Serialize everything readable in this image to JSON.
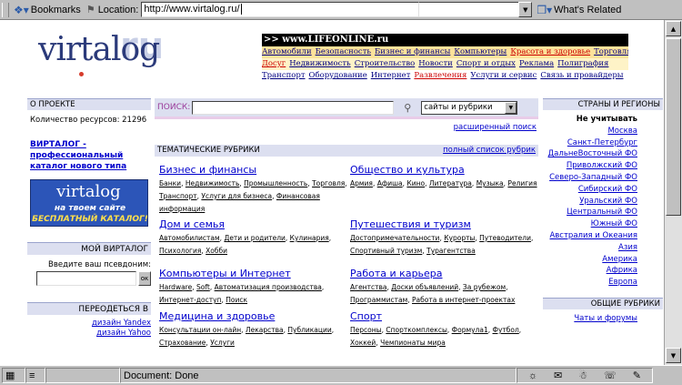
{
  "browser": {
    "bookmarks_label": "Bookmarks",
    "location_label": "Location:",
    "url": "http://www.virtalog.ru/",
    "whats_related": "What's Related",
    "status_text": "Document: Done"
  },
  "logo": {
    "text": "virtalog",
    "suffix": "ru"
  },
  "lifeonline": {
    "header": ">> www.LIFEONLINE.ru",
    "row1": [
      "Автомобили",
      "Безопасность",
      "Бизнес и финансы",
      "Компьютеры",
      "Красота и здоровье",
      "Торговля"
    ],
    "row2": [
      "Досуг",
      "Недвижимость",
      "Строительство",
      "Новости",
      "Спорт и отдых",
      "Реклама",
      "Полиграфия"
    ],
    "row3": [
      "Транспорт",
      "Оборудование",
      "Интернет",
      "Развлечения",
      "Услуги и сервис",
      "Связь и провайдеры"
    ]
  },
  "left": {
    "about_head": "О ПРОЕКТЕ",
    "resource_count": "Количество ресурсов: 21296",
    "promo_link": "ВИРТАЛОГ - профессиональный каталог нового типа",
    "banner_logo": "virtalog",
    "banner_line1": "на твоем сайте",
    "banner_line2": "БЕСПЛАТНЫЙ КАТАЛОГ!",
    "my_head": "МОЙ ВИРТАЛОГ",
    "nick_label": "Введите ваш псевдоним:",
    "ok_label": "ок",
    "goto_head": "ПЕРЕОДЕТЬСЯ В",
    "goto_links": [
      "дизайн Yandex",
      "дизайн Yahoo"
    ]
  },
  "search": {
    "label": "ПОИСК:",
    "scope": "сайты и рубрики",
    "extended": "расширенный поиск"
  },
  "rubrics": {
    "head": "ТЕМАТИЧЕСКИЕ РУБРИКИ",
    "full_list": "полный список рубрик",
    "items": [
      {
        "title": "Бизнес и финансы",
        "subs": [
          "Банки",
          "Недвижимость",
          "Промышленность",
          "Торговля",
          "Транспорт",
          "Услуги для бизнеса",
          "Финансовая информация"
        ]
      },
      {
        "title": "Общество и культура",
        "subs": [
          "Армия",
          "Афиша",
          "Кино",
          "Литература",
          "Музыка",
          "Религия"
        ]
      },
      {
        "title": "Дом и семья",
        "subs": [
          "Автомобилистам",
          "Дети и родители",
          "Кулинария",
          "Психология",
          "Хобби"
        ]
      },
      {
        "title": "Путешествия и туризм",
        "subs": [
          "Достопримечательности",
          "Курорты",
          "Путеводители",
          "Спортивный туризм",
          "Турагентства"
        ]
      },
      {
        "title": "Компьютеры и Интернет",
        "subs": [
          "Hardware",
          "Soft",
          "Автоматизация производства",
          "Интернет-доступ",
          "Поиск"
        ]
      },
      {
        "title": "Работа и карьера",
        "subs": [
          "Агентства",
          "Доски объявлений",
          "За рубежом",
          "Программистам",
          "Работа в интернет-проектах"
        ]
      },
      {
        "title": "Медицина и здоровье",
        "subs": [
          "Консультации он-лайн",
          "Лекарства",
          "Публикации",
          "Страхование",
          "Услуги"
        ]
      },
      {
        "title": "Спорт",
        "subs": [
          "Персоны",
          "Спорткомплексы",
          "Формула1",
          "Футбол",
          "Хоккей",
          "Чемпионаты мира"
        ]
      }
    ]
  },
  "right": {
    "regions_head": "СТРАНЫ И РЕГИОНЫ",
    "ignore": "Не учитывать",
    "regions": [
      "Москва",
      "Санкт-Петербург",
      "ДальнеВосточный ФО",
      "Приволжский ФО",
      "Северо-Западный ФО",
      "Сибирский ФО",
      "Уральский ФО",
      "Центральный ФО",
      "Южный ФО",
      "Австралия и Океания",
      "Азия",
      "Америка",
      "Африка",
      "Европа"
    ],
    "common_head": "ОБЩИЕ РУБРИКИ",
    "common_links": [
      "Чаты и форумы"
    ]
  }
}
